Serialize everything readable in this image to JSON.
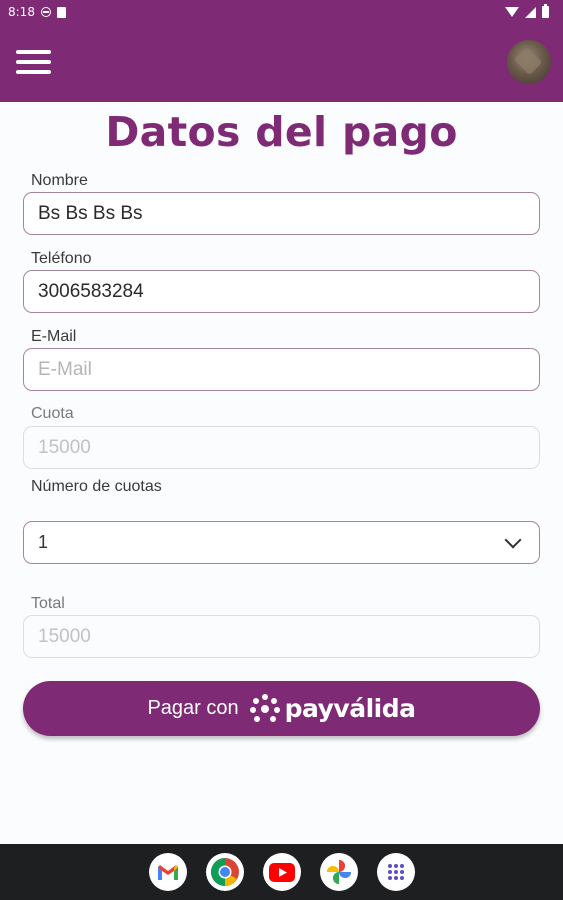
{
  "status_bar": {
    "time": "8:18"
  },
  "app_bar": {
    "menu_icon": "hamburger-menu-icon",
    "avatar_icon": "user-avatar"
  },
  "page": {
    "title": "Datos del pago"
  },
  "form": {
    "nombre": {
      "label": "Nombre",
      "value": "Bs Bs Bs Bs"
    },
    "telefono": {
      "label": "Teléfono",
      "value": "3006583284"
    },
    "email": {
      "label": "E-Mail",
      "value": "",
      "placeholder": "E-Mail"
    },
    "cuota": {
      "label": "Cuota",
      "value": "15000"
    },
    "numero_cuotas": {
      "label": "Número de cuotas",
      "selected": "1"
    },
    "total": {
      "label": "Total",
      "value": "15000"
    }
  },
  "pay_button": {
    "label": "Pagar con",
    "brand": "payválida"
  },
  "dock": [
    {
      "name": "gmail-icon"
    },
    {
      "name": "chrome-icon"
    },
    {
      "name": "youtube-icon"
    },
    {
      "name": "photos-icon"
    },
    {
      "name": "app-drawer-icon"
    }
  ],
  "colors": {
    "primary": "#7f2a74",
    "field_border": "#a4869e",
    "nav_bg": "#1d1f21"
  }
}
